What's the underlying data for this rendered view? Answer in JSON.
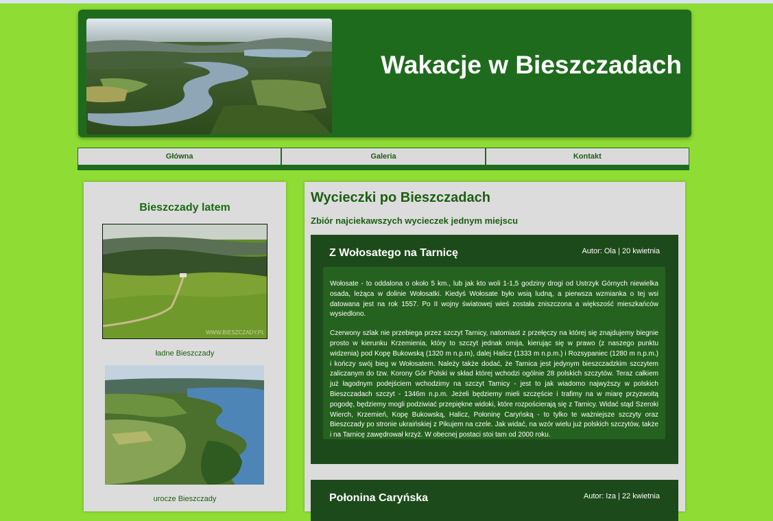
{
  "header": {
    "title": "Wakacje w Bieszczadach"
  },
  "nav": {
    "items": [
      {
        "label": "Główna"
      },
      {
        "label": "Galeria"
      },
      {
        "label": "Kontakt"
      }
    ]
  },
  "sidebar": {
    "title": "Bieszczady latem",
    "images": [
      {
        "caption": "ładne Bieszczady",
        "watermark": "WWW.BIESZCZADY.PL"
      },
      {
        "caption": "urocze Bieszczady"
      }
    ]
  },
  "main": {
    "title": "Wycieczki po Bieszczadach",
    "subtitle": "Zbiór najciekawszych wycieczek jednym miejscu",
    "articles": [
      {
        "title": "Z Wołosatego na Tarnicę",
        "meta": "Autor: Ola | 20 kwietnia",
        "paragraphs": [
          "Wołosate - to oddalona o około 5 km., lub jak kto woli 1-1,5 godziny drogi od Ustrzyk Górnych niewielka osada, leżąca w dolinie Wołosatki. Kiedyś Wołosate było wsią ludną, a pierwsza wzmianka o tej wsi datowana jest na rok 1557. Po II wojny światowej wieś została zniszczona a większość mieszkańców wysiedlono.",
          "Czerwony szlak nie przebiega przez szczyt Tarnicy, natomiast z przełęczy na której się znajdujemy biegnie prosto w kierunku Krzemienia, który to szczyt jednak omija, kierując się w prawo (z naszego punktu widzenia) pod Kopę Bukowską (1320 m n.p.m), dalej Halicz (1333 m n.p.m.) i Rozsypaniec (1280 m n.p.m.) i kończy swój bieg w Wołosatem. Należy także dodać, że Tarnica jest jedynym bieszczadzkim szczytem zaliczanym do tzw. Korony Gór Polski w skład której wchodzi ogólnie 28 polskich szczytów. Teraz całkiem już łagodnym podejściem wchodzimy na szczyt Tarnicy - jest to jak wiadomo najwyższy w polskich Bieszczadach szczyt - 1346m n.p.m. Jeżeli będziemy mieli szczęście i trafimy na w miarę przyzwoitą pogodę, będziemy mogli podziwiać przepiękne widoki, które rozpościerają się z Tarnicy. Widać stąd Szeroki Wierch, Krzemień, Kopę Bukowską, Halicz, Połoninę Caryńską - to tylko te ważniejsze szczyty oraz Bieszczady po stronie ukraińskiej z Pikujem na czele. Jak widać, na wzór wielu już polskich szczytów, także i na Tarnicę zawędrował krzyż. W obecnej postaci stoi tam od 2000 roku."
        ]
      },
      {
        "title": "Połonina Caryńska",
        "meta": "Autor: Iza | 22 kwietnia"
      }
    ]
  },
  "colors": {
    "page_bg": "#8fdc35",
    "header_bg": "#1f6b1e",
    "panel_bg": "#dcdcdc",
    "article_bg": "#1d4a1a",
    "article_body_bg": "#26621f",
    "accent_text": "#1c5e12"
  }
}
